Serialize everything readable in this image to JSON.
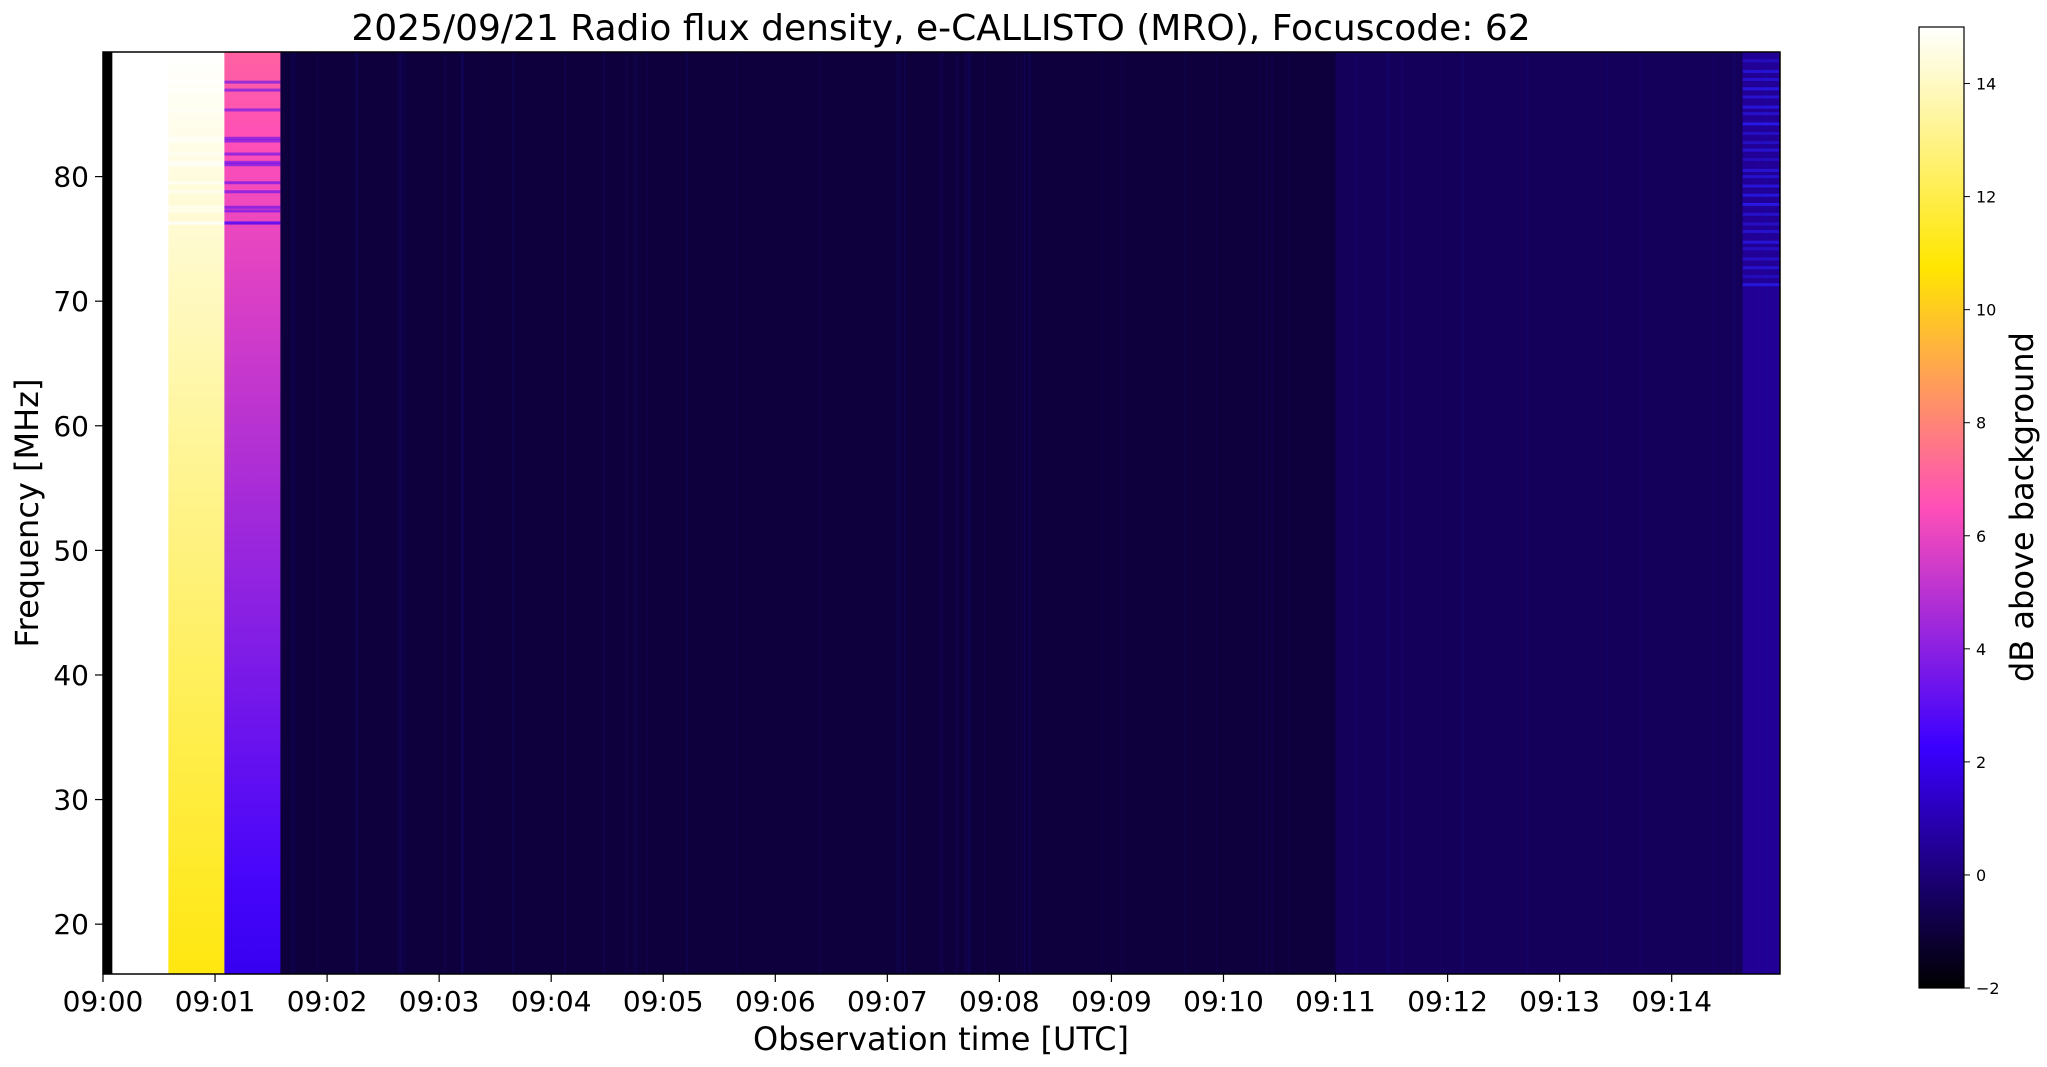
{
  "chart_data": {
    "type": "heatmap",
    "title": "2025/09/21  Radio flux density, e-CALLISTO (MRO), Focuscode: 62",
    "xlabel": "Observation time [UTC]",
    "ylabel": "Frequency [MHz]",
    "colorbar_label": "dB above background",
    "x_ticks": [
      "09:00",
      "09:01",
      "09:02",
      "09:03",
      "09:04",
      "09:05",
      "09:06",
      "09:07",
      "09:08",
      "09:09",
      "09:10",
      "09:11",
      "09:12",
      "09:13",
      "09:14"
    ],
    "xlim": [
      "09:00:00",
      "09:14:58"
    ],
    "y_ticks": [
      20,
      30,
      40,
      50,
      60,
      70,
      80
    ],
    "ylim": [
      16,
      90
    ],
    "colorbar_ticks": [
      -2,
      0,
      2,
      4,
      6,
      8,
      10,
      12,
      14
    ],
    "clim": [
      -2,
      15
    ],
    "colormap": [
      "#000000",
      "#3a00ff",
      "#ff4fb8",
      "#ffe600",
      "#ffffff"
    ],
    "grid": false,
    "bands": [
      {
        "start": "09:00:00",
        "end": "09:00:05",
        "value": -2
      },
      {
        "start": "09:00:05",
        "end": "09:00:35",
        "value": 15
      },
      {
        "start": "09:00:35",
        "end": "09:01:05",
        "value_low_freq": 11,
        "value_high_freq": 15
      },
      {
        "start": "09:01:05",
        "end": "09:01:35",
        "value_low_freq": 2,
        "value_high_freq": 7
      },
      {
        "start": "09:01:35",
        "end": "09:11:00",
        "value": -1
      },
      {
        "start": "09:11:00",
        "end": "09:14:38",
        "value": -0.5
      },
      {
        "start": "09:14:38",
        "end": "09:14:58",
        "value": 0.5
      }
    ]
  }
}
